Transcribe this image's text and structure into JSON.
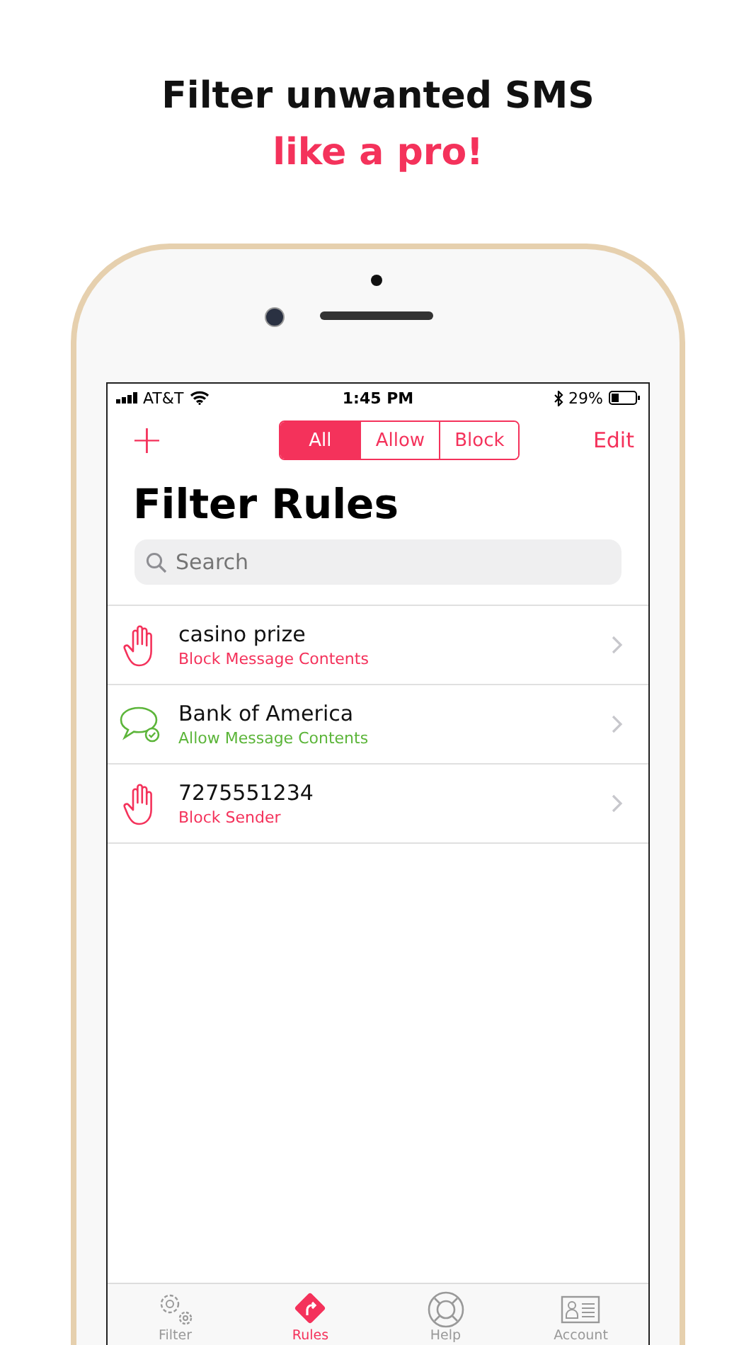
{
  "headline": {
    "line1": "Filter unwanted SMS",
    "line2": "like a pro!"
  },
  "status_bar": {
    "carrier": "AT&T",
    "time": "1:45 PM",
    "battery": "29%"
  },
  "nav": {
    "add": "+",
    "edit": "Edit"
  },
  "segments": [
    {
      "label": "All",
      "selected": true
    },
    {
      "label": "Allow",
      "selected": false
    },
    {
      "label": "Block",
      "selected": false
    }
  ],
  "title": "Filter Rules",
  "search": {
    "placeholder": "Search"
  },
  "rules": [
    {
      "name": "casino prize",
      "detail": "Block Message Contents",
      "kind": "block"
    },
    {
      "name": "Bank of America",
      "detail": "Allow Message Contents",
      "kind": "allow"
    },
    {
      "name": "7275551234",
      "detail": "Block Sender",
      "kind": "block"
    }
  ],
  "tab_bar": [
    {
      "label": "Filter",
      "kind": "gears",
      "selected": false
    },
    {
      "label": "Rules",
      "kind": "rules",
      "selected": true
    },
    {
      "label": "Help",
      "kind": "help",
      "selected": false
    },
    {
      "label": "Account",
      "kind": "account",
      "selected": false
    }
  ]
}
